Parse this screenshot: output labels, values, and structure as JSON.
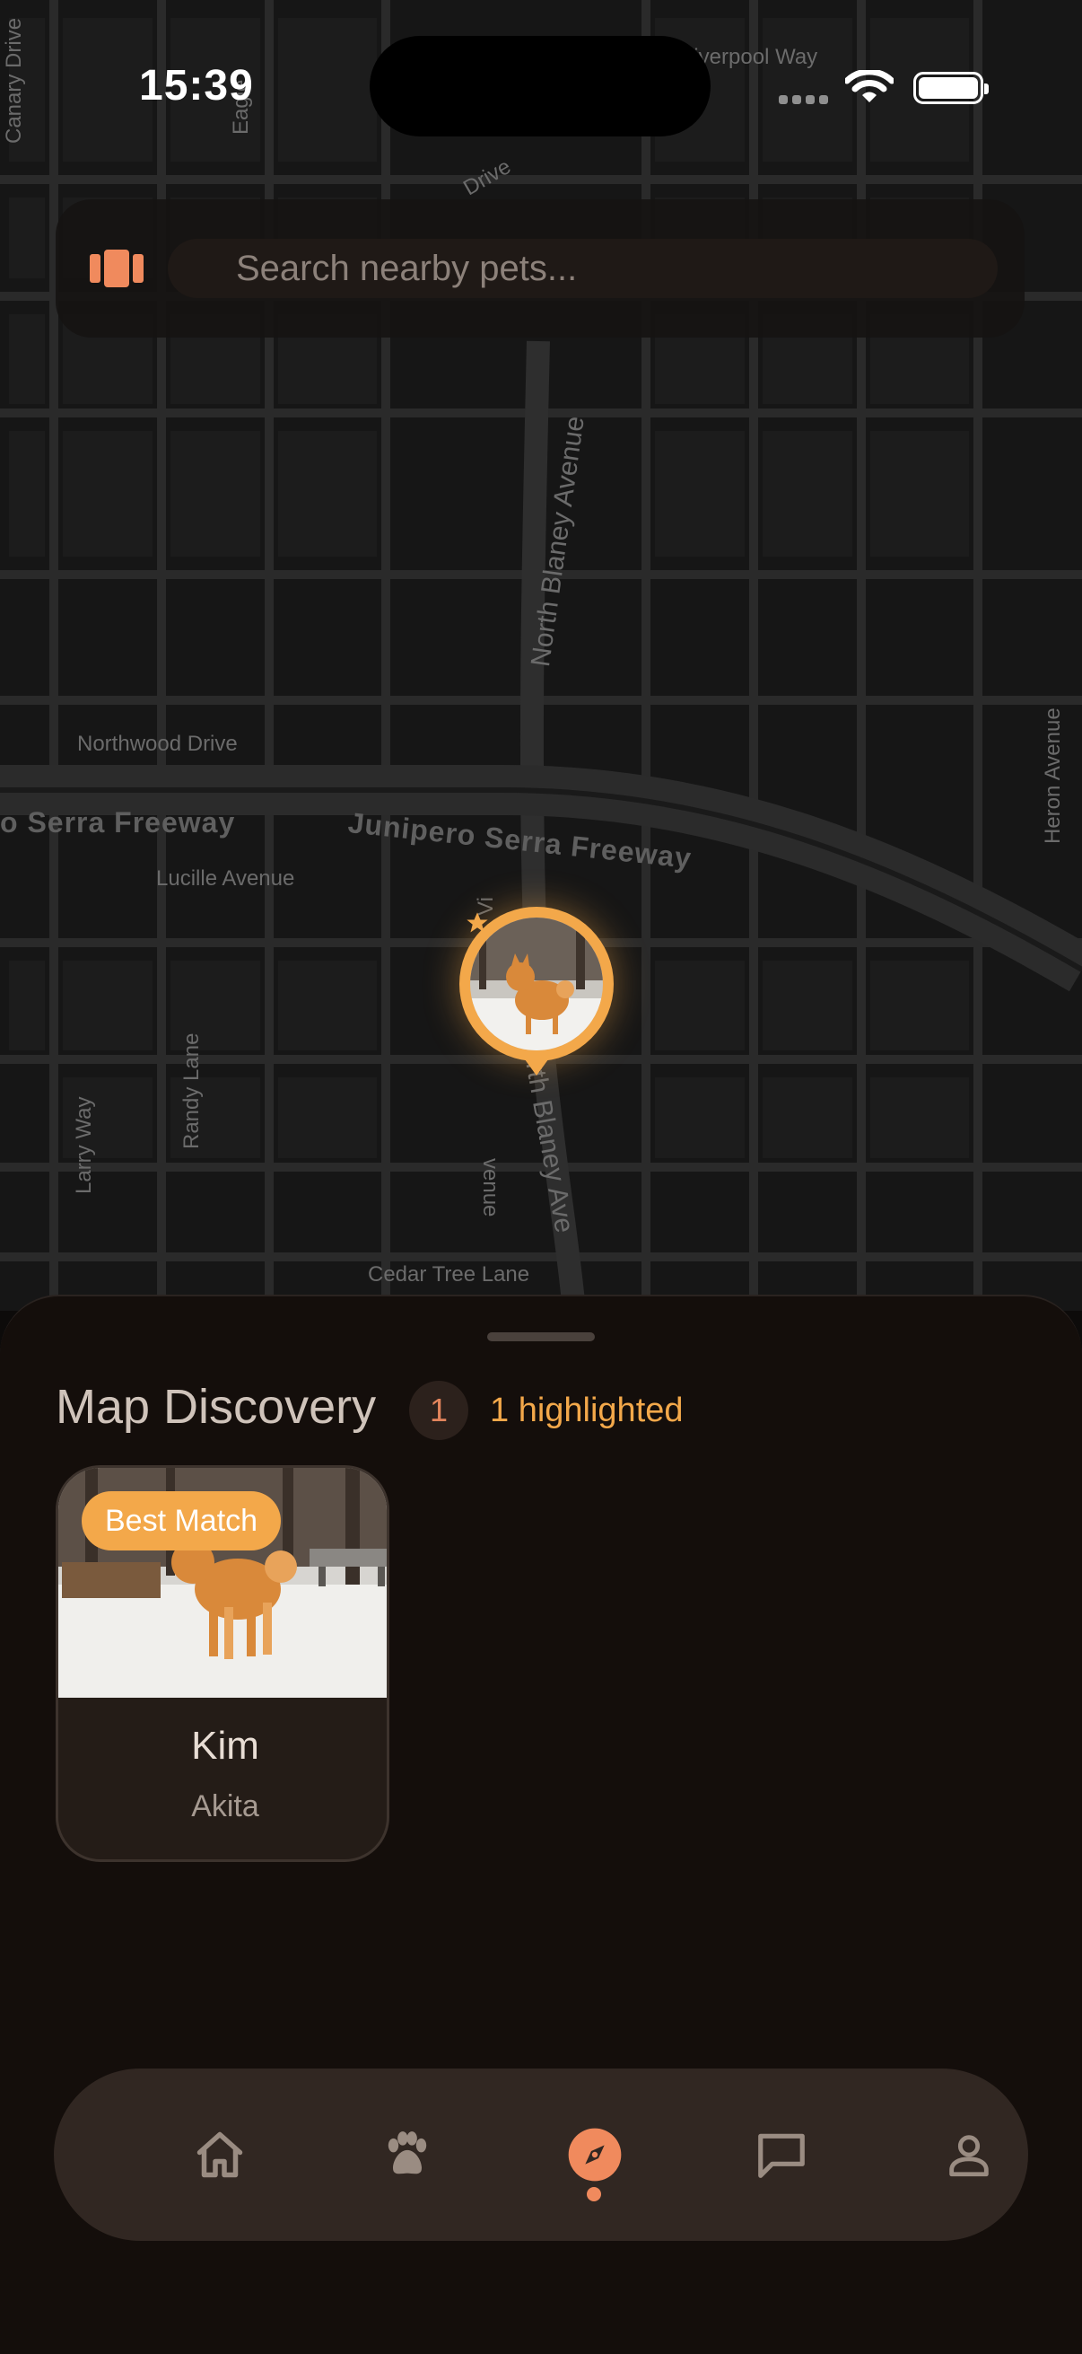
{
  "status_bar": {
    "time": "15:39"
  },
  "search": {
    "placeholder": "Search nearby pets..."
  },
  "map": {
    "streets": [
      "Northwood Drive",
      "Lucille Avenue",
      "Cedar Tree Lane",
      "Randy Lane",
      "Larry Way",
      "North Blaney Avenue",
      "Heron Avenue",
      "Liverpool Way",
      "Eagle",
      "Canary Drive",
      "Drive",
      "Vi",
      "venue",
      "rth Blaney Ave"
    ],
    "freeways": [
      "o Serra Freeway",
      "Junipero Serra Freeway"
    ]
  },
  "sheet": {
    "title": "Map Discovery",
    "count": "1",
    "highlight_label": "1 highlighted"
  },
  "pets": [
    {
      "name": "Kim",
      "breed": "Akita",
      "badge": "Best Match"
    }
  ],
  "tabs": [
    {
      "name": "home",
      "icon": "home-icon",
      "active": false
    },
    {
      "name": "pets",
      "icon": "paw-icon",
      "active": false
    },
    {
      "name": "discover",
      "icon": "compass-icon",
      "active": true
    },
    {
      "name": "messages",
      "icon": "chat-icon",
      "active": false
    },
    {
      "name": "profile",
      "icon": "user-icon",
      "active": false
    }
  ],
  "colors": {
    "accent": "#f3a84a",
    "active_tab": "#f08a5d",
    "sheet_bg": "#140e0b",
    "tab_bar_bg": "#312722"
  }
}
